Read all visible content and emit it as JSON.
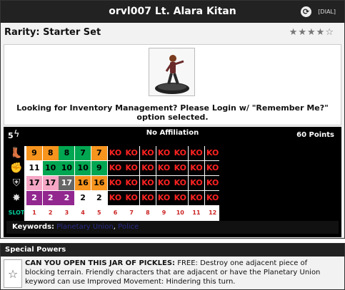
{
  "card": {
    "title": "orvl007 Lt. Alara Kitan",
    "refresh_icon": "refresh-icon",
    "dial_link": "[DIAL]"
  },
  "rarity": {
    "label": "Rarity: Starter Set",
    "stars_filled": 4,
    "stars_total": 5,
    "stars_text": "★★★★☆"
  },
  "inventory_message": "Looking for Inventory Management? Please Login w/ \"Remember Me?\" option selected.",
  "dial": {
    "range": "5",
    "affiliation": "No Affiliation",
    "points": "60 Points",
    "stats": [
      {
        "name": "speed",
        "icon": "boot-icon",
        "values": [
          "9",
          "8",
          "8",
          "7",
          "7",
          "KO",
          "KO",
          "KO",
          "KO",
          "KO",
          "KO",
          "KO"
        ],
        "colors": [
          "#f7941d",
          "#f7941d",
          "#00a651",
          "#00a651",
          "#f7941d",
          "#000",
          "#000",
          "#000",
          "#000",
          "#000",
          "#000",
          "#000"
        ]
      },
      {
        "name": "attack",
        "icon": "fist-icon",
        "values": [
          "11",
          "10",
          "10",
          "10",
          "9",
          "KO",
          "KO",
          "KO",
          "KO",
          "KO",
          "KO",
          "KO"
        ],
        "colors": [
          "#ffffff",
          "#00a651",
          "#00a651",
          "#00a651",
          "#00a651",
          "#000",
          "#000",
          "#000",
          "#000",
          "#000",
          "#000",
          "#000"
        ]
      },
      {
        "name": "defense",
        "icon": "shield-icon",
        "values": [
          "17",
          "17",
          "17",
          "16",
          "16",
          "KO",
          "KO",
          "KO",
          "KO",
          "KO",
          "KO",
          "KO"
        ],
        "colors": [
          "#f5a6c4",
          "#f5a6c4",
          "#666666",
          "#f7941d",
          "#f7941d",
          "#000",
          "#000",
          "#000",
          "#000",
          "#000",
          "#000",
          "#000"
        ]
      },
      {
        "name": "damage",
        "icon": "starburst-icon",
        "values": [
          "2",
          "2",
          "2",
          "2",
          "2",
          "KO",
          "KO",
          "KO",
          "KO",
          "KO",
          "KO",
          "KO"
        ],
        "colors": [
          "#92278f",
          "#92278f",
          "#92278f",
          "#ffffff",
          "#ffffff",
          "#000",
          "#000",
          "#000",
          "#000",
          "#000",
          "#000",
          "#000"
        ]
      }
    ],
    "slot_label": "SLOT",
    "slots": [
      "1",
      "2",
      "3",
      "4",
      "5",
      "6",
      "7",
      "8",
      "9",
      "10",
      "11",
      "12"
    ]
  },
  "keywords": {
    "label": "Keywords:",
    "items": [
      "Planetary Union",
      "Police"
    ],
    "separator": ","
  },
  "special_powers": {
    "header": "Special Powers",
    "icon": "star-icon",
    "power_title": "CAN YOU OPEN THIS JAR OF PICKLES:",
    "power_text": " FREE: Destroy one adjacent piece of blocking terrain. Friendly characters that are adjacent or have the Planetary Union keyword can use Improved Movement: Hindering this turn."
  }
}
